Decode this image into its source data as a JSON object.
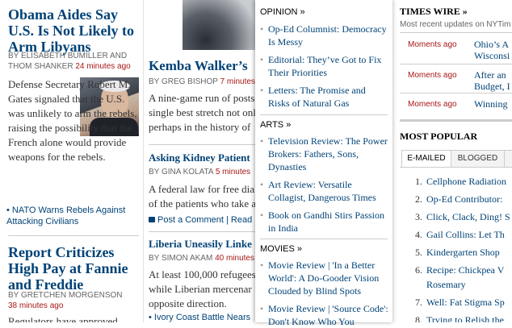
{
  "col1": {
    "story1": {
      "headline": "Obama Aides Say U.S. Is Not Likely to Arm Libyans",
      "byline_a": "By ELISABETH BUMILLER and",
      "byline_b": "THOM SHANKER",
      "time": "24 minutes ago",
      "summary": "Defense Secretary Robert M. Gates signaled that the U.S. was unlikely to arm the rebels, raising the possibility that the French alone would provide weapons for the rebels.",
      "related": "NATO Warns Rebels Against Attacking Civilians"
    },
    "story2": {
      "headline": "Report Criticizes High Pay at Fannie and Freddie",
      "byline": "By GRETCHEN MORGENSON",
      "time": "38 minutes ago",
      "summary": "Regulators have approved"
    }
  },
  "col2": {
    "story1": {
      "headline": "Kemba Walker’s",
      "byline": "By GREG BISHOP",
      "time": "7 minutes",
      "summary": "A nine-game run of posts single best stretch not onl perhaps in the history of"
    },
    "story2": {
      "headline": "Asking Kidney Patient",
      "byline": "By GINA KOLATA",
      "time": "5 minutes",
      "summary": "A federal law for free dial of the patients who take a",
      "comment": "Post a Comment | Read"
    },
    "story3": {
      "headline": "Liberia Uneasily Linke",
      "byline": "By SIMON AKAM",
      "time": "40 minutes",
      "summary": "At least 100,000 refugees while Liberian mercenar opposite direction.",
      "related": "Ivory Coast Battle Nears"
    }
  },
  "menu": {
    "opinion": {
      "title": "OPINION »",
      "items": [
        "Op-Ed Columnist: Democracy Is Messy",
        "Editorial: They’ve Got to Fix Their Priorities",
        "Letters: The Promise and Risks of Natural Gas"
      ]
    },
    "arts": {
      "title": "ARTS »",
      "items": [
        "Television Review: The Power Brokers: Fathers, Sons, Dynasties",
        "Art Review: Versatile Collagist, Dangerous Times",
        "Book on Gandhi Stirs Passion in India"
      ]
    },
    "movies": {
      "title": "MOVIES »",
      "items": [
        "Movie Review | 'In a Better World': A Do-Gooder Vision Clouded by Blind Spots",
        "Movie Review | 'Source Code': Don't Know Who You"
      ]
    }
  },
  "times_wire": {
    "title": "TIMES WIRE »",
    "subtitle": "Most recent updates on NYTim",
    "rows": [
      {
        "time": "Moments ago",
        "text": "Ohio’s A Wisconsi"
      },
      {
        "time": "Moments ago",
        "text": "After an Budget, I"
      },
      {
        "time": "Moments ago",
        "text": "Winning"
      }
    ]
  },
  "most_popular": {
    "title": "MOST POPULAR",
    "tabs": [
      "E-MAILED",
      "BLOGGED",
      ""
    ],
    "items": [
      {
        "n": "1.",
        "text": "Cellphone Radiation"
      },
      {
        "n": "2.",
        "text": "Op-Ed Contributor:"
      },
      {
        "n": "3.",
        "text": "Click, Clack, Ding! S"
      },
      {
        "n": "4.",
        "text": "Gail Collins: Let Th"
      },
      {
        "n": "5.",
        "text": "Kindergarten Shop"
      },
      {
        "n": "6.",
        "text": "Recipe: Chickpea V"
      },
      {
        "n": "",
        "text": "Rosemary"
      },
      {
        "n": "7.",
        "text": "Well: Fat Stigma Sp"
      },
      {
        "n": "8.",
        "text": "Trying to Relish the"
      }
    ]
  },
  "colors": {
    "link": "#004276",
    "timestamp": "#a81817"
  }
}
